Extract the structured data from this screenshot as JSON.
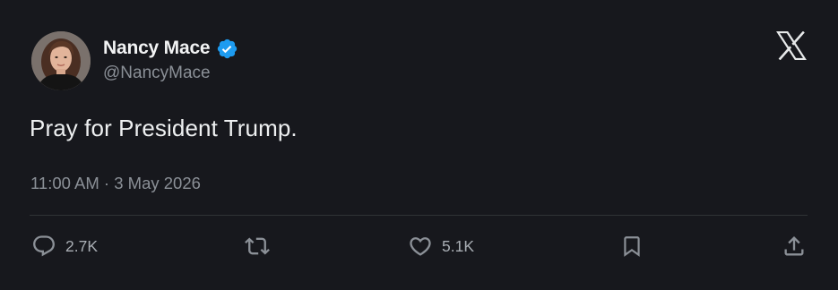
{
  "author": {
    "display_name": "Nancy Mace",
    "handle": "@NancyMace",
    "verified": true,
    "avatar": "profile-photo"
  },
  "platform_logo": "x-logo-icon",
  "tweet": {
    "text": "Pray for President Trump.",
    "timestamp": "11:00 AM · 3 May 2026"
  },
  "actions": {
    "reply": {
      "icon": "reply-icon",
      "count": "2.7K"
    },
    "retweet": {
      "icon": "retweet-icon",
      "count": ""
    },
    "like": {
      "icon": "heart-icon",
      "count": "5.1K"
    },
    "bookmark": {
      "icon": "bookmark-icon",
      "count": ""
    },
    "share": {
      "icon": "share-icon",
      "count": ""
    }
  },
  "colors": {
    "background": "#17181d",
    "verified_badge": "#1d9bf0",
    "primary_text": "#eef0f1",
    "secondary_text": "#8b9097",
    "divider": "#2f3336"
  }
}
